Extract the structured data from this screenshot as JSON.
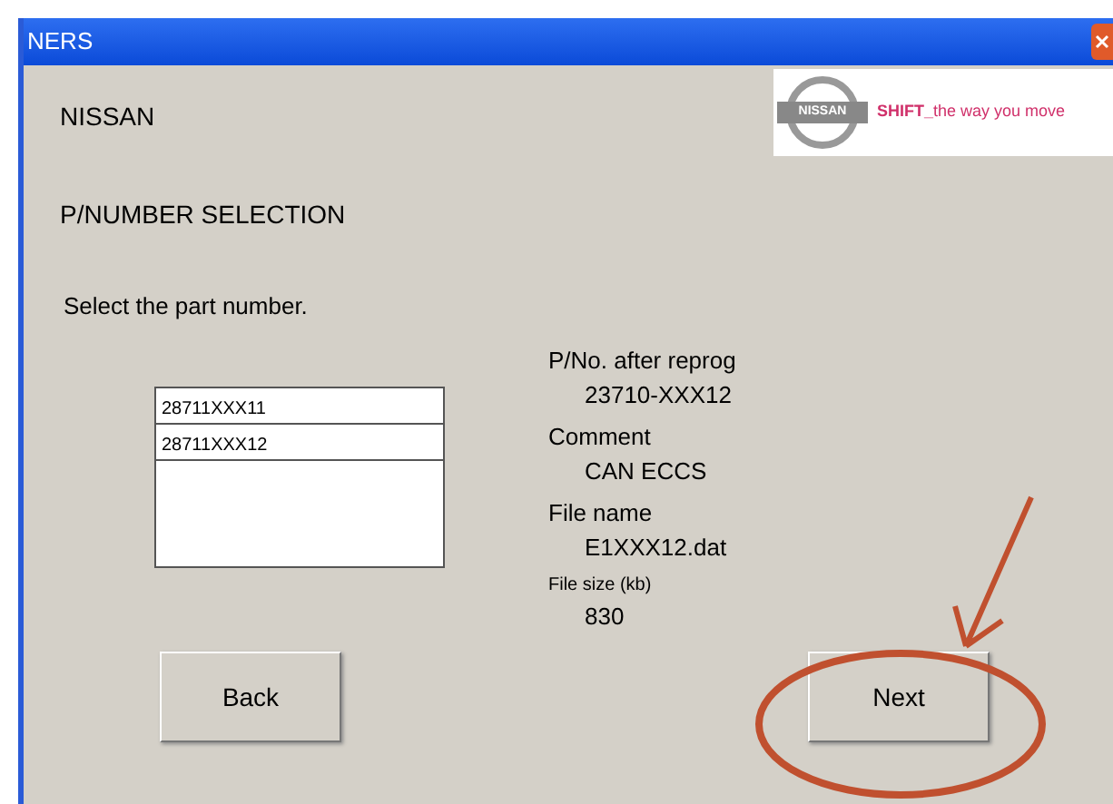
{
  "window": {
    "title": "NERS"
  },
  "brand": "NISSAN",
  "logo": {
    "emblem": "NISSAN",
    "tagline": "**SHIFT_**the way you move"
  },
  "heading": "P/NUMBER SELECTION",
  "instruction": "Select the part number.",
  "part_numbers": [
    "28711XXX11",
    "28711XXX12"
  ],
  "details": [
    {
      "label": "P/No. after reprog",
      "value": "23710-XXX12"
    },
    {
      "label": "Comment",
      "value": "CAN ECCS"
    },
    {
      "label": "File name",
      "value": "E1XXX12.dat"
    },
    {
      "label": "File size (kb)",
      "value": "830"
    }
  ],
  "buttons": [
    {
      "label": "Back"
    },
    {
      "label": "Next"
    }
  ]
}
